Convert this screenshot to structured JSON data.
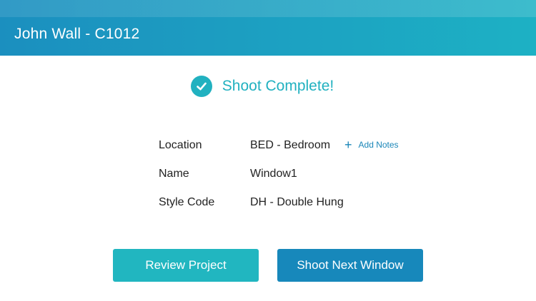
{
  "header": {
    "title": "John Wall - C1012"
  },
  "status": {
    "message": "Shoot Complete!"
  },
  "details": [
    {
      "label": "Location",
      "value": "BED - Bedroom"
    },
    {
      "label": "Name",
      "value": "Window1"
    },
    {
      "label": "Style Code",
      "value": "DH - Double Hung"
    }
  ],
  "add_notes": {
    "label": "Add Notes",
    "icon": "plus-icon"
  },
  "buttons": {
    "review_label": "Review Project",
    "next_label": "Shoot Next Window"
  },
  "colors": {
    "header_start": "#1b8fbf",
    "header_end": "#1db1c4",
    "accent_teal": "#21b1c0",
    "accent_blue": "#1788bb",
    "link_blue": "#1a86b8"
  }
}
